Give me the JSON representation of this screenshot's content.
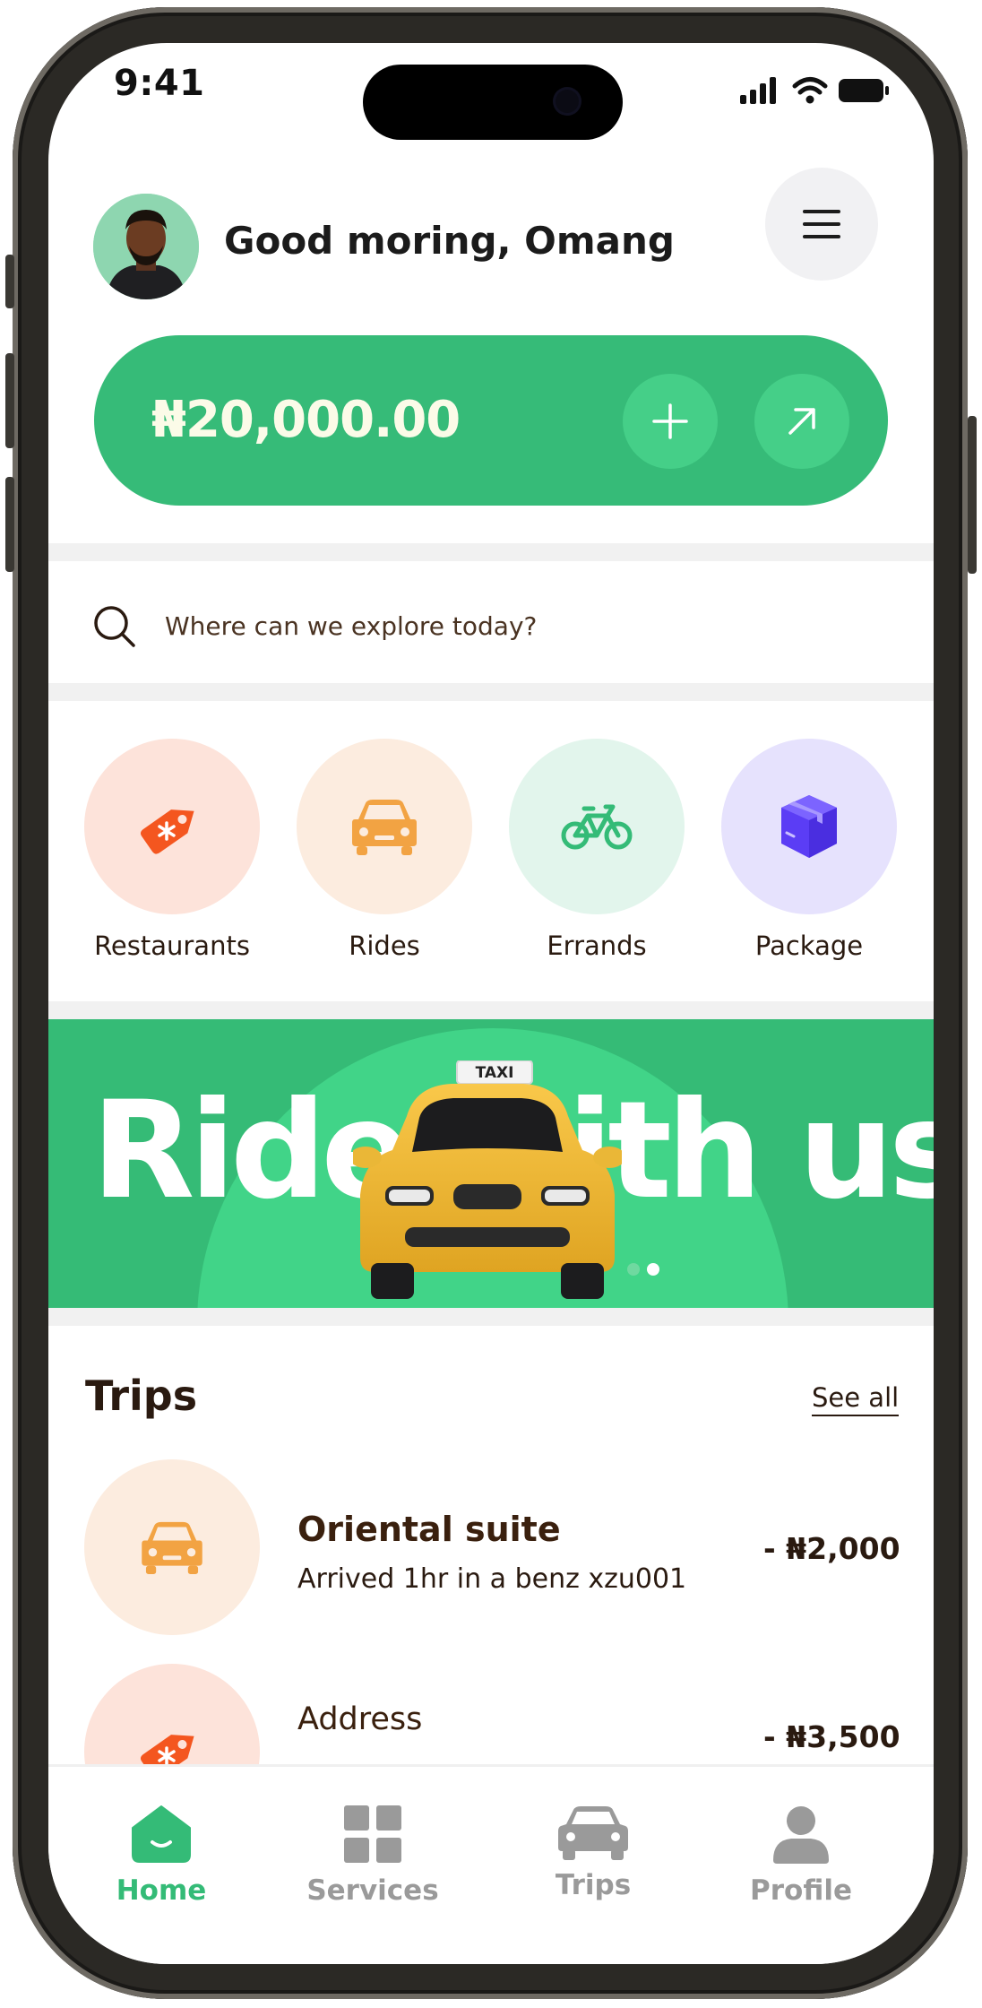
{
  "status_bar": {
    "time": "9:41"
  },
  "header": {
    "greeting": "Good moring, Omang"
  },
  "wallet": {
    "balance": "₦20,000.00"
  },
  "search": {
    "placeholder": "Where can we explore today?"
  },
  "categories": [
    {
      "label": "Restaurants",
      "icon": "tag-icon",
      "bg": "#fde3da",
      "color": "#f4561f"
    },
    {
      "label": "Rides",
      "icon": "car-icon",
      "bg": "#fcecdf",
      "color": "#f2a343"
    },
    {
      "label": "Errands",
      "icon": "bicycle-icon",
      "bg": "#e2f5ec",
      "color": "#34bb77"
    },
    {
      "label": "Package",
      "icon": "box-icon",
      "bg": "#e6e2fd",
      "color": "#5b3df5"
    }
  ],
  "promo": {
    "text": "Ride with us",
    "sign": "TAXI",
    "active_slide": 2,
    "slides": 2
  },
  "trips": {
    "title": "Trips",
    "see_all": "See all",
    "items": [
      {
        "name": "Oriental suite",
        "detail": "Arrived 1hr in a benz xzu001",
        "amount": "- ₦2,000",
        "icon": "car-icon"
      },
      {
        "name": "Address",
        "detail": "",
        "amount": "- ₦3,500",
        "icon": "tag-icon"
      }
    ]
  },
  "bottom_nav": {
    "items": [
      {
        "label": "Home",
        "icon": "home-icon",
        "active": true
      },
      {
        "label": "Services",
        "icon": "grid-icon",
        "active": false
      },
      {
        "label": "Trips",
        "icon": "car-icon",
        "active": false
      },
      {
        "label": "Profile",
        "icon": "user-icon",
        "active": false
      }
    ]
  },
  "colors": {
    "brand_green": "#36bb78",
    "active_nav": "#34bb77",
    "inactive_nav": "#9a9a9a",
    "text_dark_brown": "#2a1a10"
  }
}
